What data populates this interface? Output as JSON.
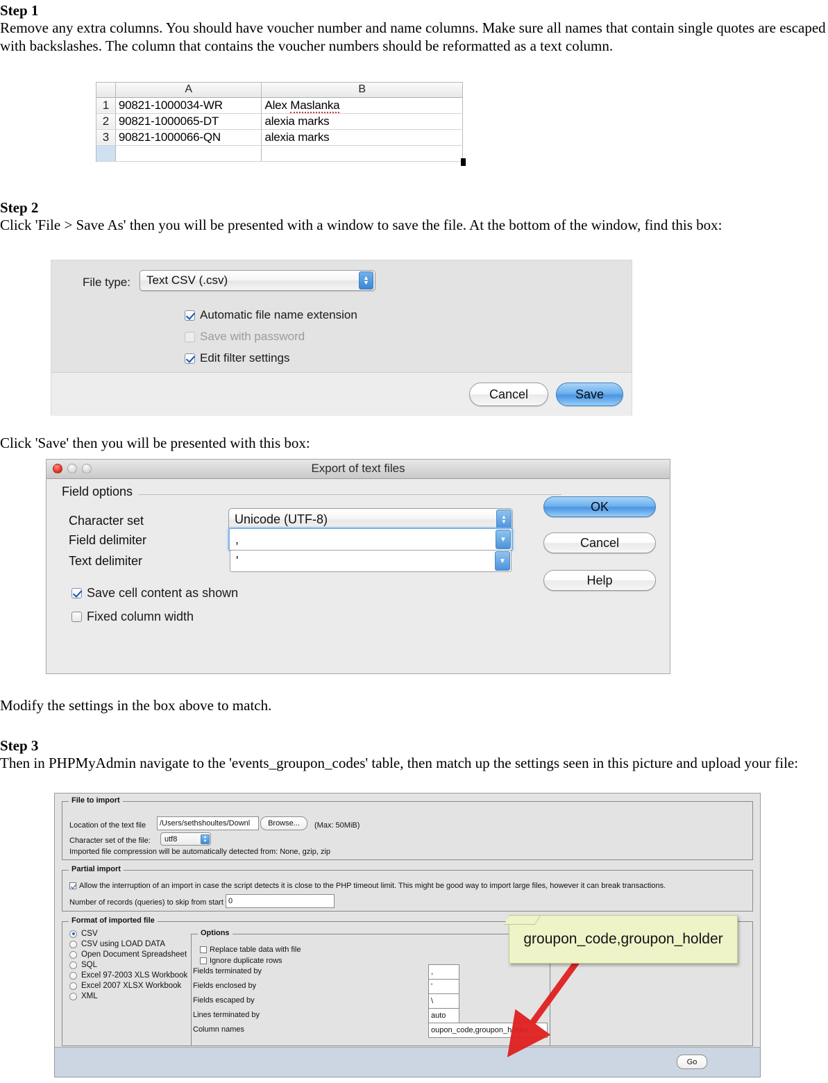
{
  "doc": {
    "step1": {
      "heading": "Step 1",
      "body": "Remove any extra columns. You should have voucher number and name columns. Make sure  all names that contain single quotes are escaped with backslashes. The column that contains the voucher numbers should be reformatted as a text column."
    },
    "step2": {
      "heading": "Step 2",
      "body": "Click 'File > Save As' then you will be presented with a window to save the file. At the bottom of the window, find this box:",
      "after_dialog": "Click 'Save' then you will be presented with this box:",
      "after_export": "Modify the settings in the box above to match."
    },
    "step3": {
      "heading": "Step 3",
      "body": "Then in PHPMyAdmin navigate to the 'events_groupon_codes' table, then match up the settings seen in this picture and upload your file:"
    }
  },
  "spreadsheet": {
    "columns": [
      "A",
      "B"
    ],
    "rows": [
      {
        "num": "1",
        "a": "90821-1000034-WR",
        "b": "Alex Maslanka",
        "misspelled": "Maslanka",
        "b_prefix": "Alex "
      },
      {
        "num": "2",
        "a": "90821-1000065-DT",
        "b": "alexia marks",
        "misspelled": "",
        "b_prefix": "alexia marks"
      },
      {
        "num": "3",
        "a": "90821-1000066-QN",
        "b": "alexia marks",
        "misspelled": "",
        "b_prefix": "alexia marks"
      }
    ]
  },
  "save_dialog": {
    "file_type_label": "File type:",
    "file_type_value": "Text CSV (.csv)",
    "checkboxes": [
      {
        "label": "Automatic file name extension",
        "checked": true,
        "disabled": false
      },
      {
        "label": "Save with password",
        "checked": false,
        "disabled": true
      },
      {
        "label": "Edit filter settings",
        "checked": true,
        "disabled": false
      }
    ],
    "cancel_label": "Cancel",
    "save_label": "Save"
  },
  "export_dialog": {
    "title": "Export of text files",
    "group_legend": "Field options",
    "charset_label": "Character set",
    "charset_value": "Unicode (UTF-8)",
    "field_delim_label": "Field delimiter",
    "field_delim_value": ",",
    "text_delim_label": "Text delimiter",
    "text_delim_value": "'",
    "checkboxes": [
      {
        "label": "Save cell content as shown",
        "checked": true
      },
      {
        "label": "Fixed column width",
        "checked": false
      }
    ],
    "ok_label": "OK",
    "cancel_label": "Cancel",
    "help_label": "Help"
  },
  "pma": {
    "file_to_import": {
      "legend": "File to import",
      "location_label": "Location of the text file",
      "location_value": "/Users/sethshoultes/Downl",
      "browse_label": "Browse...",
      "max_note": "(Max: 50MiB)",
      "charset_label": "Character set of the file:",
      "charset_value": "utf8",
      "compression_note": "Imported file compression will be automatically detected from: None, gzip, zip"
    },
    "partial_import": {
      "legend": "Partial import",
      "allow_label": "Allow the interruption of an import in case the script detects it is close to the PHP timeout limit. This might be good way to import large files, however it can break transactions.",
      "allow_checked": true,
      "skip_label": "Number of records (queries) to skip from start",
      "skip_value": "0"
    },
    "format": {
      "legend": "Format of imported file",
      "radios": [
        {
          "label": "CSV",
          "selected": true
        },
        {
          "label": "CSV using LOAD DATA",
          "selected": false
        },
        {
          "label": "Open Document Spreadsheet",
          "selected": false
        },
        {
          "label": "SQL",
          "selected": false
        },
        {
          "label": "Excel 97-2003 XLS Workbook",
          "selected": false
        },
        {
          "label": "Excel 2007 XLSX Workbook",
          "selected": false
        },
        {
          "label": "XML",
          "selected": false
        }
      ]
    },
    "options": {
      "legend": "Options",
      "checkboxes": [
        {
          "label": "Replace table data with file",
          "checked": false
        },
        {
          "label": "Ignore duplicate rows",
          "checked": false
        }
      ],
      "fields": [
        {
          "label": "Fields terminated by",
          "value": ","
        },
        {
          "label": "Fields enclosed by",
          "value": "'"
        },
        {
          "label": "Fields escaped by",
          "value": "\\"
        },
        {
          "label": "Lines terminated by",
          "value": "auto"
        },
        {
          "label": "Column names",
          "value": "oupon_code,groupon_holder"
        }
      ]
    },
    "go_label": "Go"
  },
  "callout": {
    "text": "groupon_code,groupon_holder",
    "bg_color": "#eef3c8",
    "arrow_color": "#e02020"
  }
}
